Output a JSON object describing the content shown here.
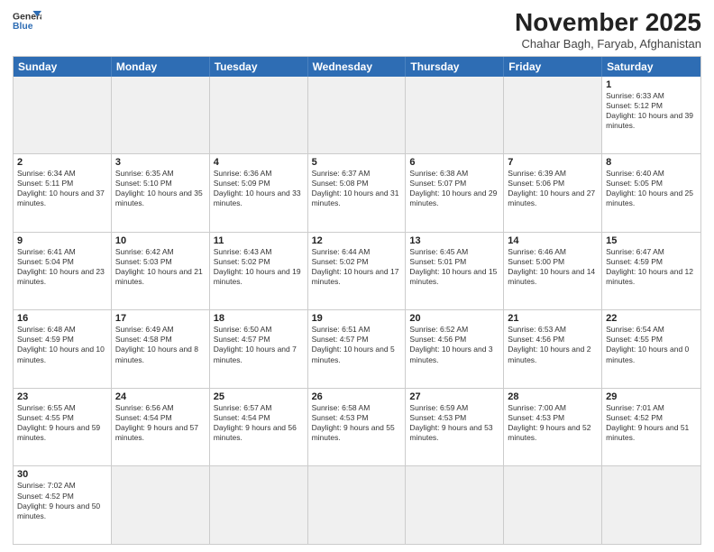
{
  "header": {
    "logo_line1": "General",
    "logo_line2": "Blue",
    "month_title": "November 2025",
    "location": "Chahar Bagh, Faryab, Afghanistan"
  },
  "weekdays": [
    "Sunday",
    "Monday",
    "Tuesday",
    "Wednesday",
    "Thursday",
    "Friday",
    "Saturday"
  ],
  "rows": [
    [
      {
        "day": "",
        "info": "",
        "empty": true
      },
      {
        "day": "",
        "info": "",
        "empty": true
      },
      {
        "day": "",
        "info": "",
        "empty": true
      },
      {
        "day": "",
        "info": "",
        "empty": true
      },
      {
        "day": "",
        "info": "",
        "empty": true
      },
      {
        "day": "",
        "info": "",
        "empty": true
      },
      {
        "day": "1",
        "info": "Sunrise: 6:33 AM\nSunset: 5:12 PM\nDaylight: 10 hours and 39 minutes."
      }
    ],
    [
      {
        "day": "2",
        "info": "Sunrise: 6:34 AM\nSunset: 5:11 PM\nDaylight: 10 hours and 37 minutes."
      },
      {
        "day": "3",
        "info": "Sunrise: 6:35 AM\nSunset: 5:10 PM\nDaylight: 10 hours and 35 minutes."
      },
      {
        "day": "4",
        "info": "Sunrise: 6:36 AM\nSunset: 5:09 PM\nDaylight: 10 hours and 33 minutes."
      },
      {
        "day": "5",
        "info": "Sunrise: 6:37 AM\nSunset: 5:08 PM\nDaylight: 10 hours and 31 minutes."
      },
      {
        "day": "6",
        "info": "Sunrise: 6:38 AM\nSunset: 5:07 PM\nDaylight: 10 hours and 29 minutes."
      },
      {
        "day": "7",
        "info": "Sunrise: 6:39 AM\nSunset: 5:06 PM\nDaylight: 10 hours and 27 minutes."
      },
      {
        "day": "8",
        "info": "Sunrise: 6:40 AM\nSunset: 5:05 PM\nDaylight: 10 hours and 25 minutes."
      }
    ],
    [
      {
        "day": "9",
        "info": "Sunrise: 6:41 AM\nSunset: 5:04 PM\nDaylight: 10 hours and 23 minutes."
      },
      {
        "day": "10",
        "info": "Sunrise: 6:42 AM\nSunset: 5:03 PM\nDaylight: 10 hours and 21 minutes."
      },
      {
        "day": "11",
        "info": "Sunrise: 6:43 AM\nSunset: 5:02 PM\nDaylight: 10 hours and 19 minutes."
      },
      {
        "day": "12",
        "info": "Sunrise: 6:44 AM\nSunset: 5:02 PM\nDaylight: 10 hours and 17 minutes."
      },
      {
        "day": "13",
        "info": "Sunrise: 6:45 AM\nSunset: 5:01 PM\nDaylight: 10 hours and 15 minutes."
      },
      {
        "day": "14",
        "info": "Sunrise: 6:46 AM\nSunset: 5:00 PM\nDaylight: 10 hours and 14 minutes."
      },
      {
        "day": "15",
        "info": "Sunrise: 6:47 AM\nSunset: 4:59 PM\nDaylight: 10 hours and 12 minutes."
      }
    ],
    [
      {
        "day": "16",
        "info": "Sunrise: 6:48 AM\nSunset: 4:59 PM\nDaylight: 10 hours and 10 minutes."
      },
      {
        "day": "17",
        "info": "Sunrise: 6:49 AM\nSunset: 4:58 PM\nDaylight: 10 hours and 8 minutes."
      },
      {
        "day": "18",
        "info": "Sunrise: 6:50 AM\nSunset: 4:57 PM\nDaylight: 10 hours and 7 minutes."
      },
      {
        "day": "19",
        "info": "Sunrise: 6:51 AM\nSunset: 4:57 PM\nDaylight: 10 hours and 5 minutes."
      },
      {
        "day": "20",
        "info": "Sunrise: 6:52 AM\nSunset: 4:56 PM\nDaylight: 10 hours and 3 minutes."
      },
      {
        "day": "21",
        "info": "Sunrise: 6:53 AM\nSunset: 4:56 PM\nDaylight: 10 hours and 2 minutes."
      },
      {
        "day": "22",
        "info": "Sunrise: 6:54 AM\nSunset: 4:55 PM\nDaylight: 10 hours and 0 minutes."
      }
    ],
    [
      {
        "day": "23",
        "info": "Sunrise: 6:55 AM\nSunset: 4:55 PM\nDaylight: 9 hours and 59 minutes."
      },
      {
        "day": "24",
        "info": "Sunrise: 6:56 AM\nSunset: 4:54 PM\nDaylight: 9 hours and 57 minutes."
      },
      {
        "day": "25",
        "info": "Sunrise: 6:57 AM\nSunset: 4:54 PM\nDaylight: 9 hours and 56 minutes."
      },
      {
        "day": "26",
        "info": "Sunrise: 6:58 AM\nSunset: 4:53 PM\nDaylight: 9 hours and 55 minutes."
      },
      {
        "day": "27",
        "info": "Sunrise: 6:59 AM\nSunset: 4:53 PM\nDaylight: 9 hours and 53 minutes."
      },
      {
        "day": "28",
        "info": "Sunrise: 7:00 AM\nSunset: 4:53 PM\nDaylight: 9 hours and 52 minutes."
      },
      {
        "day": "29",
        "info": "Sunrise: 7:01 AM\nSunset: 4:52 PM\nDaylight: 9 hours and 51 minutes."
      }
    ],
    [
      {
        "day": "30",
        "info": "Sunrise: 7:02 AM\nSunset: 4:52 PM\nDaylight: 9 hours and 50 minutes."
      },
      {
        "day": "",
        "info": "",
        "empty": true
      },
      {
        "day": "",
        "info": "",
        "empty": true
      },
      {
        "day": "",
        "info": "",
        "empty": true
      },
      {
        "day": "",
        "info": "",
        "empty": true
      },
      {
        "day": "",
        "info": "",
        "empty": true
      },
      {
        "day": "",
        "info": "",
        "empty": true
      }
    ]
  ]
}
